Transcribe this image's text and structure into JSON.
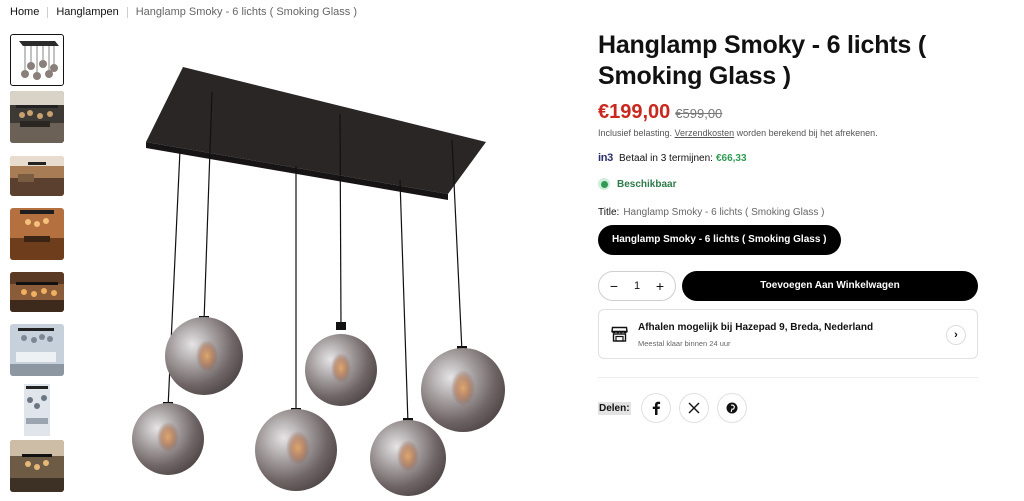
{
  "breadcrumb": {
    "home": "Home",
    "category": "Hanglampen",
    "current": "Hanglamp Smoky - 6 lichts ( Smoking Glass )"
  },
  "product": {
    "title": "Hanglamp Smoky - 6 lichts ( Smoking Glass )",
    "price": "€199,00",
    "compare_price": "€599,00",
    "tax_note_before": "Inclusief belasting. ",
    "tax_note_link": "Verzendkosten",
    "tax_note_after": " worden berekend bij het afrekenen."
  },
  "in3": {
    "logo": "in3",
    "text": "Betaal in 3 termijnen:",
    "amount": "€66,33"
  },
  "stock": {
    "label": "Beschikbaar",
    "color": "#2f9b54"
  },
  "variant": {
    "label": "Title:",
    "value": "Hanglamp Smoky - 6 lichts ( Smoking Glass )",
    "option": "Hanglamp Smoky - 6 lichts ( Smoking Glass )"
  },
  "cart": {
    "quantity": "1",
    "minus": "−",
    "plus": "+",
    "add_label": "Toevoegen Aan Winkelwagen"
  },
  "pickup": {
    "title": "Afhalen mogelijk bij Hazepad 9, Breda, Nederland",
    "subtitle": "Meestal klaar binnen 24 uur",
    "icon": "store-icon"
  },
  "share": {
    "label": "Delen:",
    "networks": [
      "facebook-icon",
      "x-icon",
      "pinterest-icon"
    ]
  },
  "colors": {
    "price": "#c8281e",
    "primary_button": "#000000",
    "in3_amount": "#2f9b54"
  }
}
